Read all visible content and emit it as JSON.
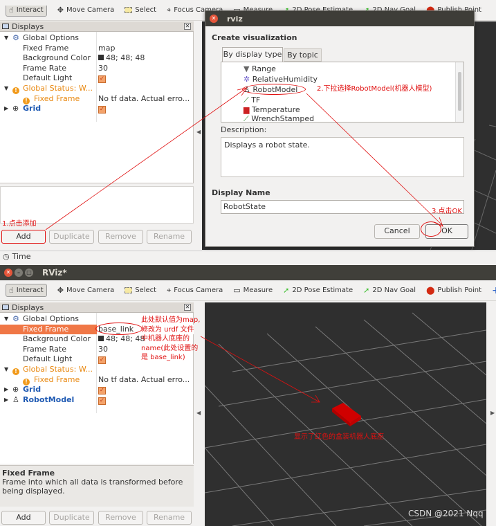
{
  "toolbar": {
    "items": [
      {
        "label": "Interact",
        "icon": "hand-icon"
      },
      {
        "label": "Move Camera",
        "icon": "move-camera-icon"
      },
      {
        "label": "Select",
        "icon": "select-icon"
      },
      {
        "label": "Focus Camera",
        "icon": "focus-camera-icon"
      },
      {
        "label": "Measure",
        "icon": "measure-icon"
      },
      {
        "label": "2D Pose Estimate",
        "icon": "pose-arrow-icon"
      },
      {
        "label": "2D Nav Goal",
        "icon": "nav-goal-icon"
      },
      {
        "label": "Publish Point",
        "icon": "publish-point-icon"
      }
    ],
    "plus": "+",
    "minus": "—"
  },
  "top": {
    "displays_title": "Displays",
    "tree": {
      "global_options": "Global Options",
      "fixed_frame": "Fixed Frame",
      "fixed_frame_val": "map",
      "bg_color": "Background Color",
      "bg_color_val": "48; 48; 48",
      "frame_rate": "Frame Rate",
      "frame_rate_val": "30",
      "default_light": "Default Light",
      "global_status": "Global Status: W...",
      "fixed_frame_err": "Fixed Frame",
      "fixed_frame_err_val": "No tf data.  Actual erro...",
      "grid": "Grid"
    },
    "displays_title2": "Displays",
    "buttons": {
      "add": "Add",
      "duplicate": "Duplicate",
      "remove": "Remove",
      "rename": "Rename"
    },
    "time_label": "Time",
    "ann1": "1.点击添加",
    "ann2": "2.下拉选择RobotModel(机器人模型)",
    "ann3": "3.点击OK"
  },
  "dialog": {
    "title": "rviz",
    "heading": "Create visualization",
    "tabs": [
      "By display type",
      "By topic"
    ],
    "list": [
      "Range",
      "RelativeHumidity",
      "RobotModel",
      "TF",
      "Temperature",
      "WrenchStamped"
    ],
    "description_label": "Description:",
    "description": "Displays a robot state.",
    "display_name_label": "Display Name",
    "display_name": "RobotState",
    "cancel": "Cancel",
    "ok": "OK"
  },
  "bottom": {
    "window_title": "RViz*",
    "displays_title": "Displays",
    "tree": {
      "global_options": "Global Options",
      "fixed_frame": "Fixed Frame",
      "fixed_frame_val": "base_link",
      "bg_color": "Background Color",
      "bg_color_val": "48; 48; 48",
      "frame_rate": "Frame Rate",
      "frame_rate_val": "30",
      "default_light": "Default Light",
      "global_status": "Global Status: W...",
      "fixed_frame_err": "Fixed Frame",
      "fixed_frame_err_val": "No tf data.  Actual erro...",
      "grid": "Grid",
      "robot_model": "RobotModel"
    },
    "help_title": "Fixed Frame",
    "help_text": "Frame into which all data is transformed before being displayed.",
    "buttons": {
      "add": "Add",
      "duplicate": "Duplicate",
      "remove": "Remove",
      "rename": "Rename"
    },
    "ann_fixed": [
      "此处默认值为map,",
      "修改为 urdf 文件",
      "中机器人底座的",
      "name(此处设置的",
      "是 base_link)"
    ],
    "ann_robot": "显示了红色的盒装机器人底座",
    "watermark": "CSDN @2021 Nqq"
  },
  "colors": {
    "selected_row": "#f07746",
    "robot": "#d00000",
    "annotation": "#e01010",
    "grid_bg": "#2f2f2f"
  }
}
